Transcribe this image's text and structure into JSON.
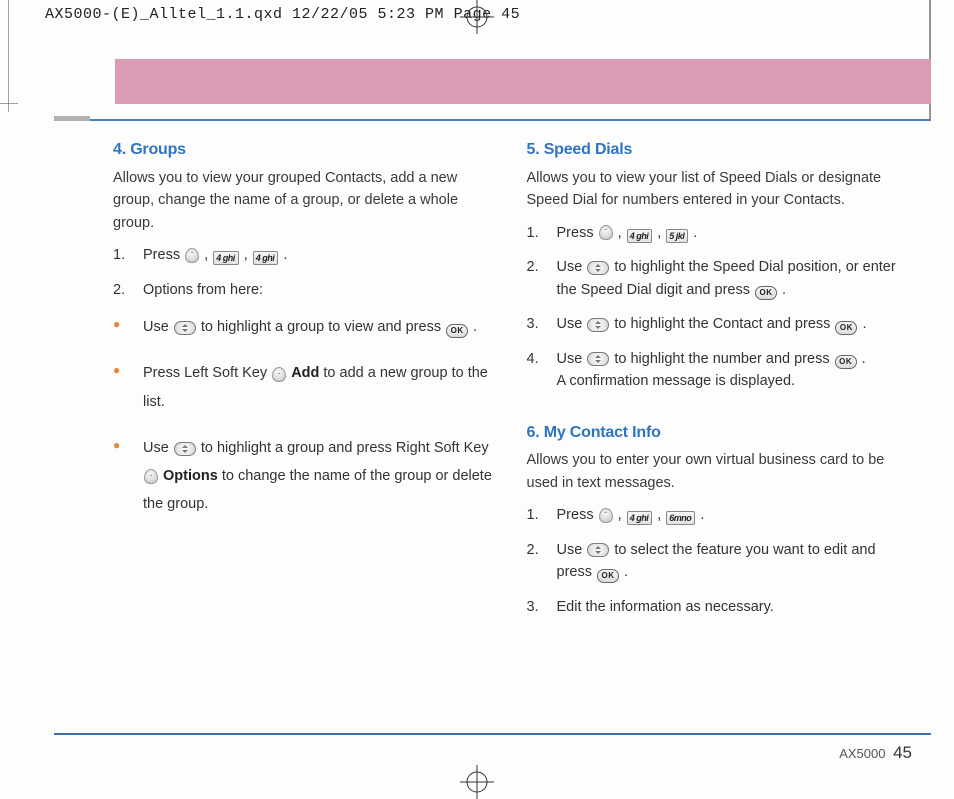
{
  "slug": "AX5000-(E)_Alltel_1.1.qxd  12/22/05  5:23 PM  Page 45",
  "footer_model": "AX5000",
  "footer_page": "45",
  "keys": {
    "k4": "4 ghi",
    "k5": "5 jkl",
    "k6": "6mno",
    "ok": "OK"
  },
  "left": {
    "sec4": {
      "title": "4. Groups",
      "intro": "Allows you to view your grouped Contacts, add a new group, change the name of a group, or delete a whole group.",
      "step1_a": "Press ",
      "step1_b": " , ",
      "step1_c": " , ",
      "step1_d": " .",
      "step2": "Options from here:",
      "b1_a": "Use ",
      "b1_b": " to highlight a group to view and press ",
      "b1_c": " .",
      "b2_a": "Press Left Soft Key ",
      "b2_bold": "Add",
      "b2_b": " to add a new group to the list.",
      "b3_a": "Use ",
      "b3_b": " to highlight a group and press Right Soft Key ",
      "b3_bold": "Options",
      "b3_c": " to change the name of the group or delete the group."
    }
  },
  "right": {
    "sec5": {
      "title": "5. Speed Dials",
      "intro": "Allows you to view your list of Speed Dials or designate Speed Dial for numbers entered in your Contacts.",
      "s1_a": "Press ",
      "s1_b": " , ",
      "s1_c": " , ",
      "s1_d": " .",
      "s2_a": "Use ",
      "s2_b": " to highlight the Speed Dial position, or enter the Speed Dial digit and press ",
      "s2_c": " .",
      "s3_a": "Use ",
      "s3_b": " to highlight the Contact and press ",
      "s3_c": " .",
      "s4_a": "Use ",
      "s4_b": " to highlight the number and press ",
      "s4_c": " .",
      "s4_d": "A confirmation message is displayed."
    },
    "sec6": {
      "title": "6. My Contact Info",
      "intro": "Allows you to enter your own virtual business card to be used in text messages.",
      "s1_a": "Press ",
      "s1_b": " , ",
      "s1_c": " , ",
      "s1_d": " .",
      "s2_a": "Use ",
      "s2_b": " to select the feature you want to edit and press ",
      "s2_c": " .",
      "s3": "Edit the information as necessary."
    }
  }
}
